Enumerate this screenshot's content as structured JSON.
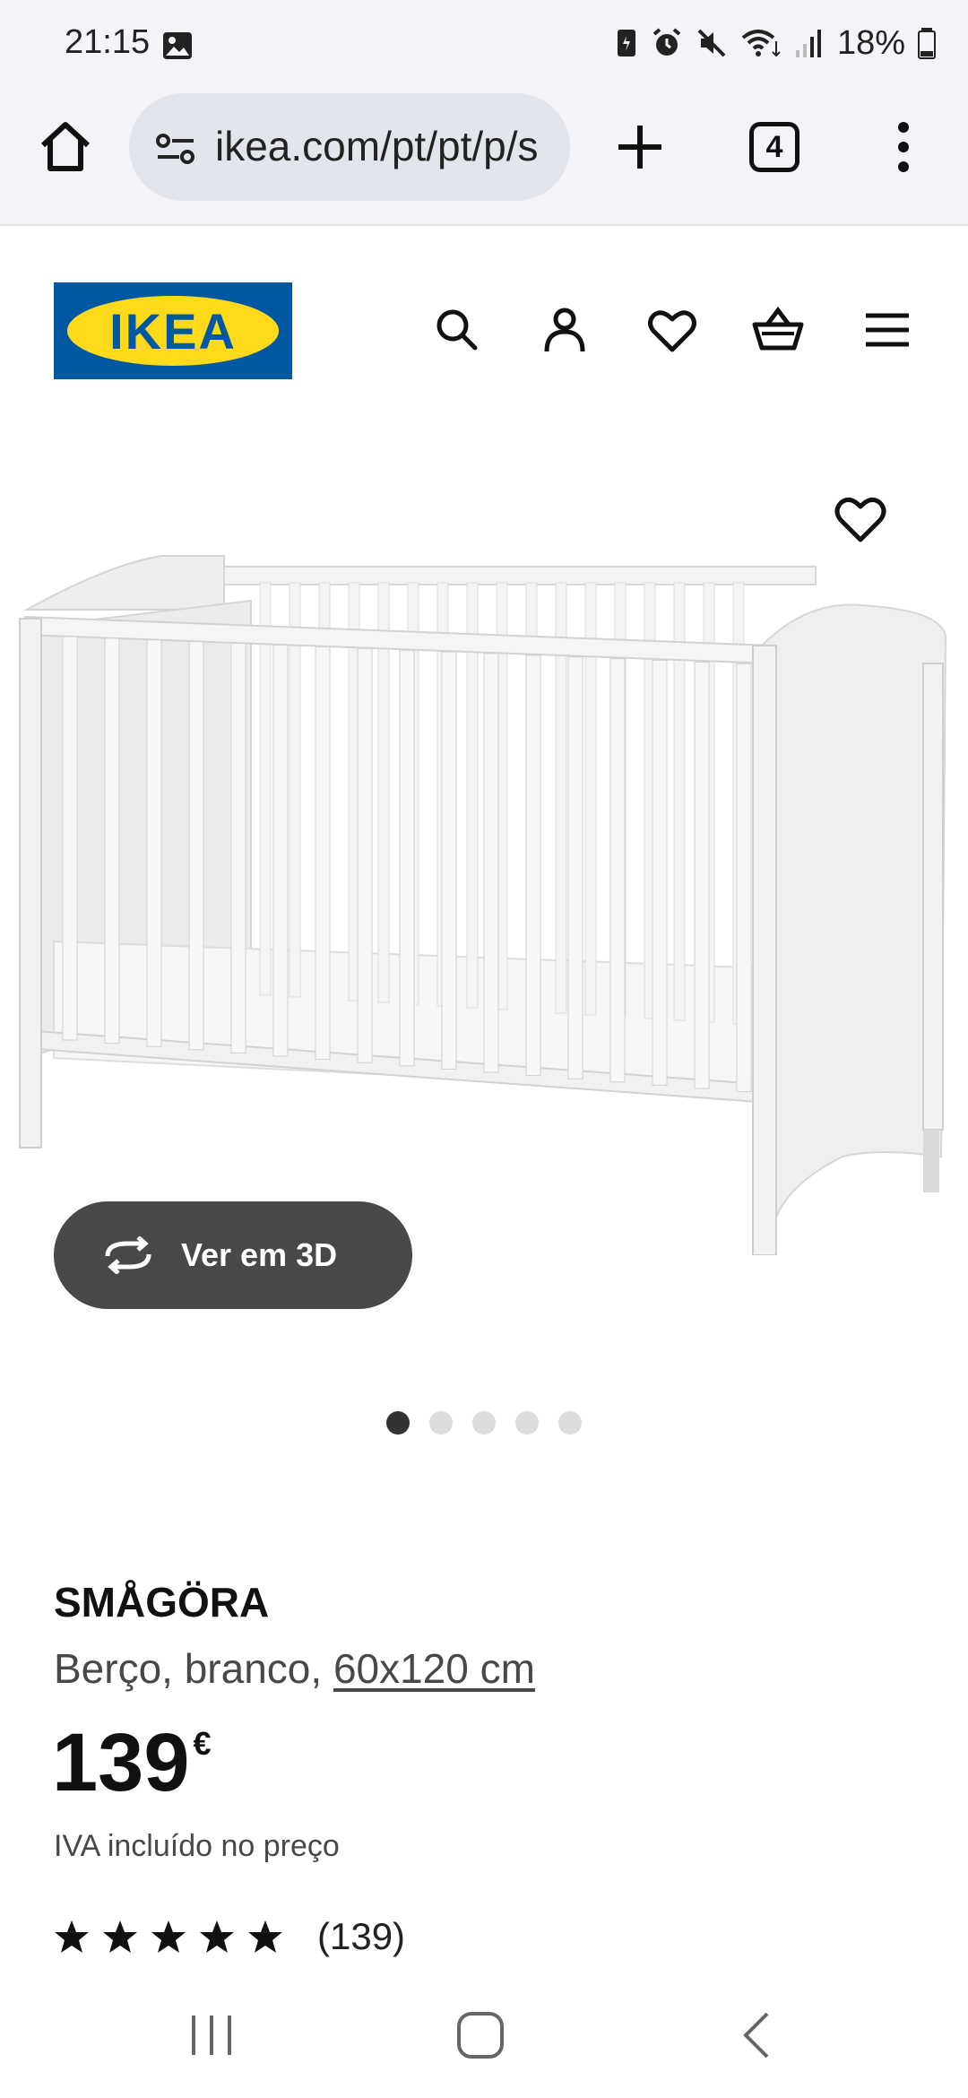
{
  "status_bar": {
    "time": "21:15",
    "battery": "18%"
  },
  "browser": {
    "url": "ikea.com/pt/pt/p/s",
    "tab_count": "4"
  },
  "header": {
    "logo_text": "IKEA",
    "icons": [
      "search-icon",
      "profile-icon",
      "heart-icon",
      "basket-icon",
      "menu-icon"
    ]
  },
  "gallery": {
    "view_3d_label": "Ver em 3D",
    "image_count": 5,
    "active_index": 0
  },
  "product": {
    "name": "SMÅGÖRA",
    "description": "Berço, branco, ",
    "size": "60x120 cm",
    "price": "139",
    "currency": "€",
    "vat_note": "IVA incluído no preço",
    "rating": 5,
    "review_count": "(139)"
  },
  "colors": {
    "ikea_blue": "#0058a3",
    "ikea_yellow": "#ffda1a",
    "button_dark": "#484848"
  }
}
